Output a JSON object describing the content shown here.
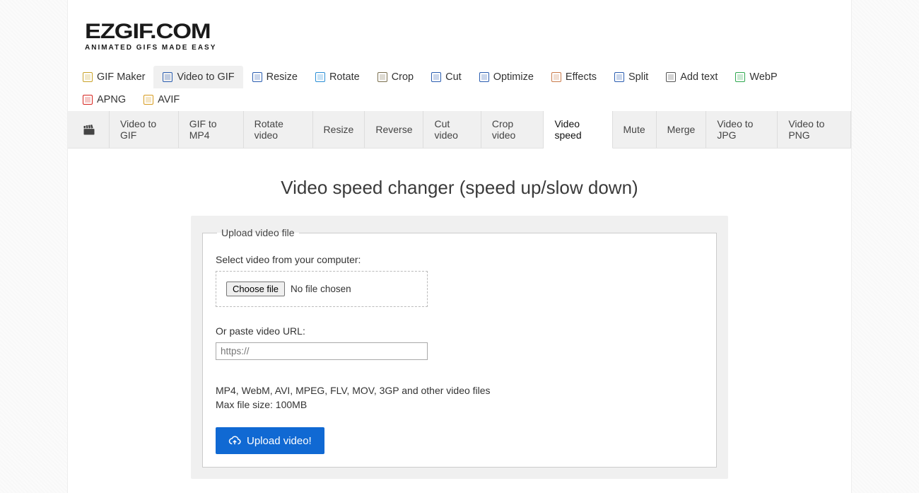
{
  "logo": {
    "main": "EZGIF.COM",
    "sub": "ANIMATED GIFS MADE EASY"
  },
  "main_nav": [
    {
      "label": "GIF Maker",
      "active": false,
      "icon_color": "#c9a227",
      "icon_name": "gif-maker-icon"
    },
    {
      "label": "Video to GIF",
      "active": true,
      "icon_color": "#2a5db0",
      "icon_name": "video-to-gif-icon"
    },
    {
      "label": "Resize",
      "active": false,
      "icon_color": "#2a5db0",
      "icon_name": "resize-icon"
    },
    {
      "label": "Rotate",
      "active": false,
      "icon_color": "#2a8fd6",
      "icon_name": "rotate-icon"
    },
    {
      "label": "Crop",
      "active": false,
      "icon_color": "#7a6f4e",
      "icon_name": "crop-icon"
    },
    {
      "label": "Cut",
      "active": false,
      "icon_color": "#2a5db0",
      "icon_name": "cut-icon"
    },
    {
      "label": "Optimize",
      "active": false,
      "icon_color": "#2a5db0",
      "icon_name": "optimize-icon"
    },
    {
      "label": "Effects",
      "active": false,
      "icon_color": "#c97a4a",
      "icon_name": "effects-icon"
    },
    {
      "label": "Split",
      "active": false,
      "icon_color": "#2a5db0",
      "icon_name": "split-icon"
    },
    {
      "label": "Add text",
      "active": false,
      "icon_color": "#555",
      "icon_name": "add-text-icon"
    },
    {
      "label": "WebP",
      "active": false,
      "icon_color": "#2fa84f",
      "icon_name": "webp-icon"
    },
    {
      "label": "APNG",
      "active": false,
      "icon_color": "#d6221c",
      "icon_name": "apng-icon"
    },
    {
      "label": "AVIF",
      "active": false,
      "icon_color": "#d69a1c",
      "icon_name": "avif-icon"
    }
  ],
  "sub_nav": [
    {
      "label": "Video to GIF",
      "active": false
    },
    {
      "label": "GIF to MP4",
      "active": false
    },
    {
      "label": "Rotate video",
      "active": false
    },
    {
      "label": "Resize",
      "active": false
    },
    {
      "label": "Reverse",
      "active": false
    },
    {
      "label": "Cut video",
      "active": false
    },
    {
      "label": "Crop video",
      "active": false
    },
    {
      "label": "Video speed",
      "active": true
    },
    {
      "label": "Mute",
      "active": false
    },
    {
      "label": "Merge",
      "active": false
    },
    {
      "label": "Video to JPG",
      "active": false
    },
    {
      "label": "Video to PNG",
      "active": false
    }
  ],
  "page_title": "Video speed changer (speed up/slow down)",
  "form": {
    "legend": "Upload video file",
    "select_label": "Select video from your computer:",
    "choose_file_btn": "Choose file",
    "no_file_text": "No file chosen",
    "url_label": "Or paste video URL:",
    "url_placeholder": "https://",
    "hint_line1": "MP4, WebM, AVI, MPEG, FLV, MOV, 3GP and other video files",
    "hint_line2": "Max file size: 100MB",
    "upload_btn": "Upload video!"
  }
}
